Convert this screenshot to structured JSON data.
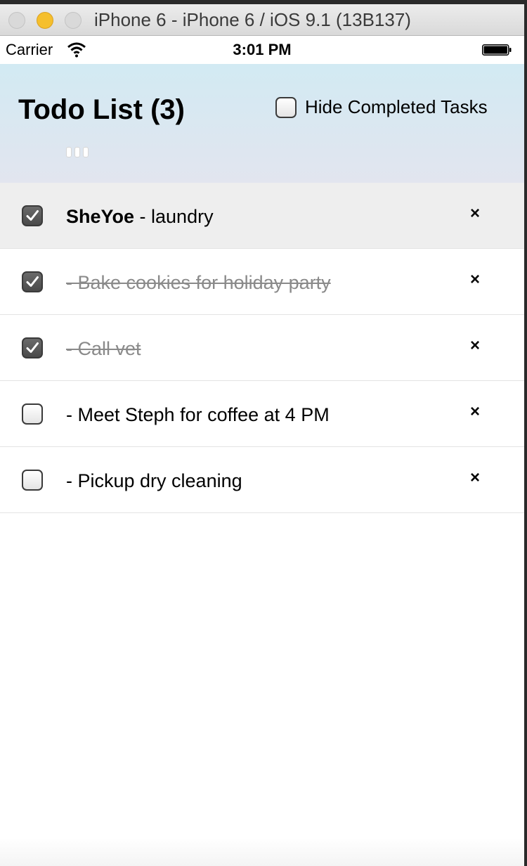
{
  "window": {
    "title": "iPhone 6 - iPhone 6 / iOS 9.1 (13B137)"
  },
  "status_bar": {
    "carrier": "Carrier",
    "time": "3:01 PM"
  },
  "header": {
    "title": "Todo List (3)",
    "hide_completed_label": "Hide Completed Tasks",
    "hide_completed_checked": false,
    "background_colors": [
      "#d2eaf3",
      "#e2e5ef"
    ]
  },
  "tasks": [
    {
      "user": "SheYoe",
      "text": " - laundry",
      "checked": true,
      "completed_style": false,
      "selected": true
    },
    {
      "user": "",
      "text": "- Bake cookies for holiday party",
      "checked": true,
      "completed_style": true,
      "selected": false
    },
    {
      "user": "",
      "text": "- Call vet",
      "checked": true,
      "completed_style": true,
      "selected": false
    },
    {
      "user": "",
      "text": "- Meet Steph for coffee at 4 PM",
      "checked": false,
      "completed_style": false,
      "selected": false
    },
    {
      "user": "",
      "text": "- Pickup dry cleaning",
      "checked": false,
      "completed_style": false,
      "selected": false
    }
  ],
  "delete_label": "×",
  "icons": {
    "wifi": "wifi-icon",
    "battery": "battery-icon",
    "check": "checkmark-icon",
    "delete": "close-icon"
  }
}
